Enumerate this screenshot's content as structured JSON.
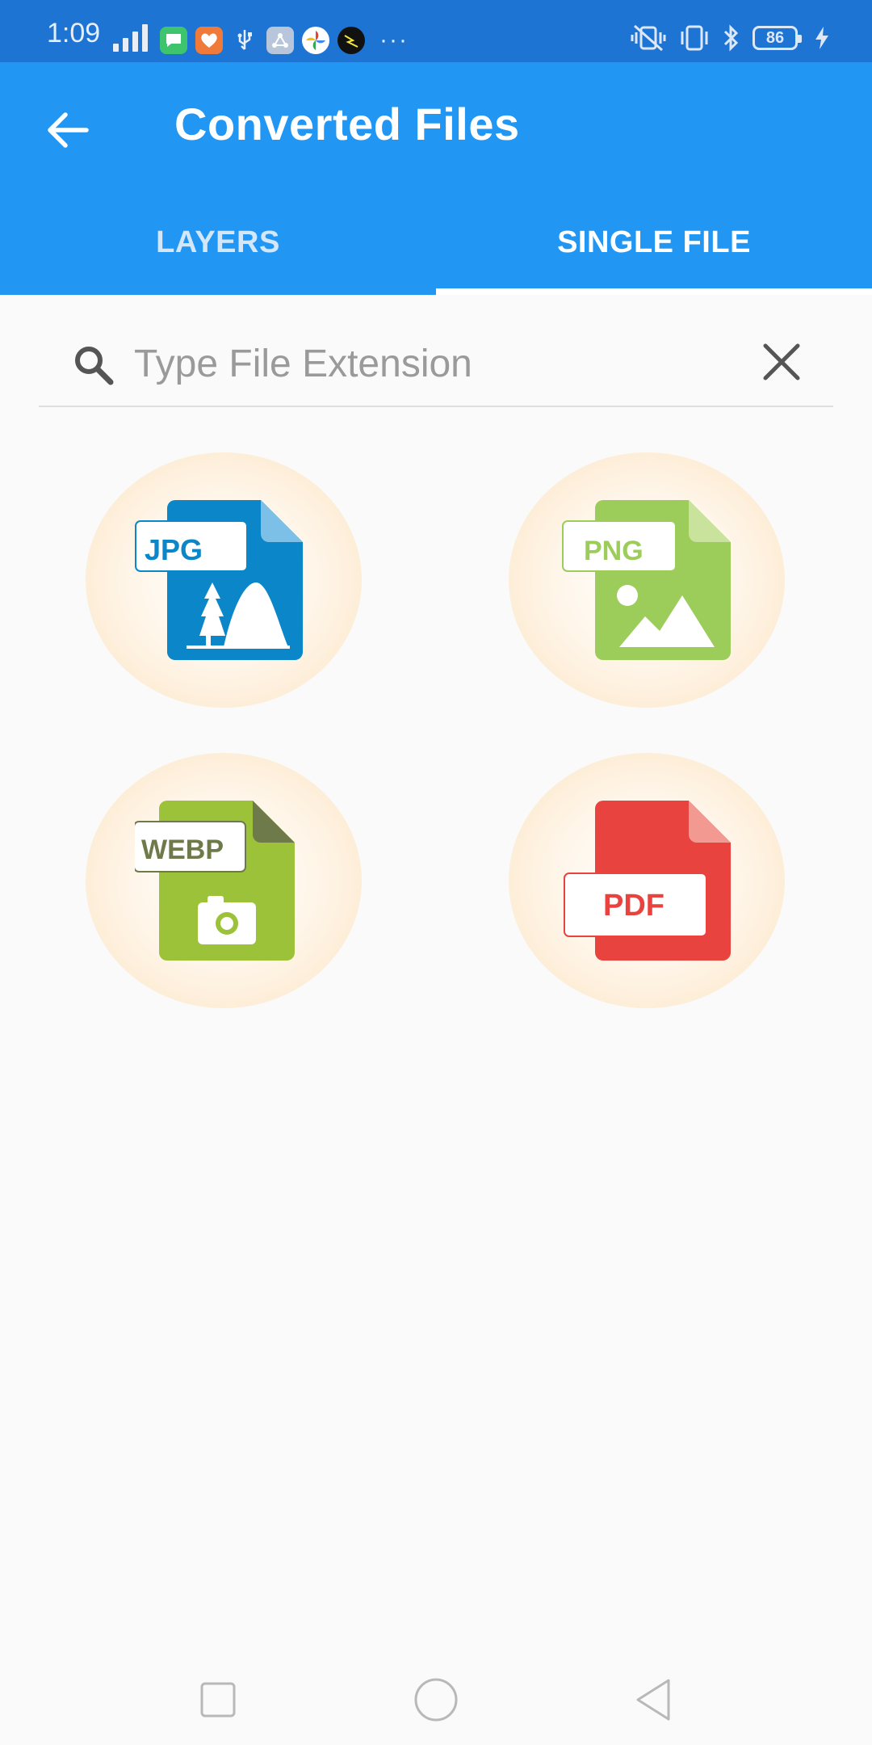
{
  "status_bar": {
    "time": "1:09",
    "battery": "86",
    "more": "···"
  },
  "app_bar": {
    "title": "Converted Files",
    "tabs": [
      {
        "label": "LAYERS",
        "active": false
      },
      {
        "label": "SINGLE FILE",
        "active": true
      }
    ]
  },
  "search": {
    "placeholder": "Type File Extension",
    "value": ""
  },
  "file_types": [
    {
      "label": "JPG",
      "color": "#0b86c8",
      "icon": "jpg-file-icon"
    },
    {
      "label": "PNG",
      "color": "#9ccc5a",
      "icon": "png-file-icon"
    },
    {
      "label": "WEBP",
      "color": "#9cc23a",
      "icon": "webp-file-icon"
    },
    {
      "label": "PDF",
      "color": "#e8433f",
      "icon": "pdf-file-icon"
    }
  ],
  "colors": {
    "status_bar": "#1e74d2",
    "app_bar": "#2196f3",
    "background": "#fafafa"
  }
}
